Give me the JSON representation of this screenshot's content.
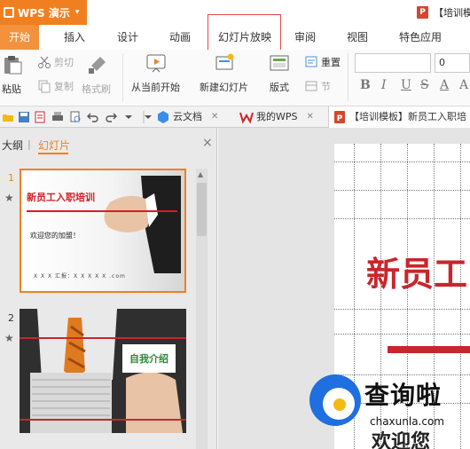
{
  "app": {
    "name": "WPS 演示",
    "caret": "▾"
  },
  "document": {
    "title": "【培训模"
  },
  "ribbon_tabs": [
    {
      "label": "开始",
      "active": true
    },
    {
      "label": "插入"
    },
    {
      "label": "设计"
    },
    {
      "label": "动画"
    },
    {
      "label": "幻灯片放映"
    },
    {
      "label": "审阅"
    },
    {
      "label": "视图"
    },
    {
      "label": "特色应用"
    }
  ],
  "toolbar": {
    "cut": "剪切",
    "copy": "复制",
    "format_painter": "格式刷",
    "paste": "粘贴",
    "from_current": "从当前开始",
    "new_slide": "新建幻灯片",
    "layout": "版式",
    "reset": "重置",
    "section": "节",
    "font_size": "0",
    "font_value": ""
  },
  "format_buttons": [
    "B",
    "I",
    "U",
    "S",
    "A",
    "A"
  ],
  "doc_tabs": [
    {
      "label": "云文档"
    },
    {
      "label": "我的WPS"
    },
    {
      "label": "【培训模板】新员工入职培"
    }
  ],
  "panel": {
    "outline": "大纲",
    "slides": "幻灯片",
    "divider": "|",
    "close": "×"
  },
  "slides": [
    {
      "number": "1",
      "title": "新员工入职培训",
      "welcome": "欢迎您的加盟！",
      "footer": "X X X        汇报：X X X X X .com"
    },
    {
      "number": "2",
      "label": "自我介绍"
    }
  ],
  "main_slide": {
    "title": "新员工",
    "welcome": "欢迎您"
  },
  "watermark": {
    "brand": "查询啦",
    "url": "chaxunla.com"
  },
  "colors": {
    "accent": "#f0801f",
    "red": "#c8262c"
  }
}
